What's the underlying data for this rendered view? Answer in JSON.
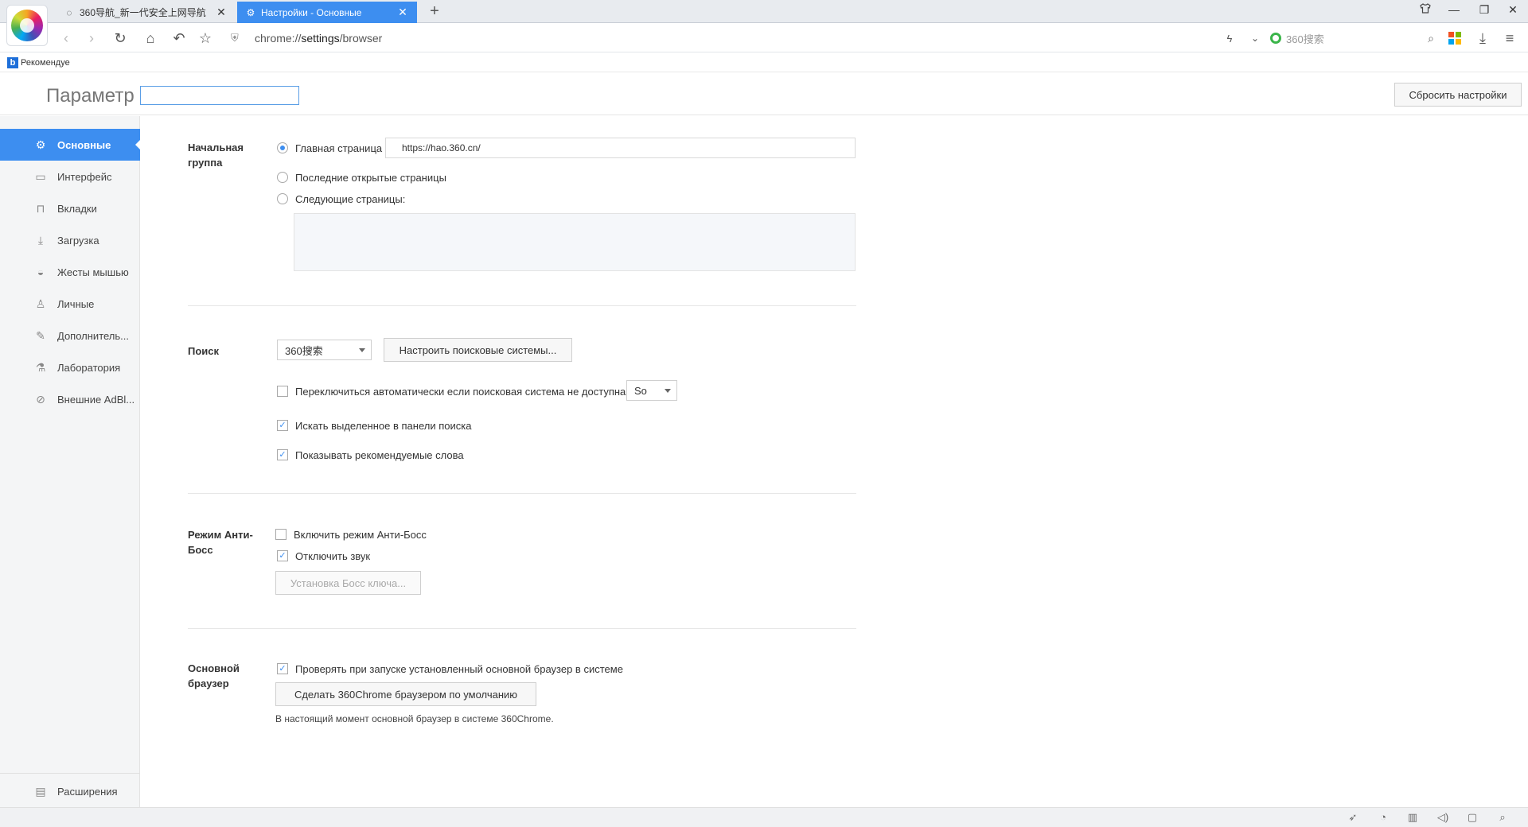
{
  "browser": {
    "tabs": [
      {
        "title": "360导航_新一代安全上网导航",
        "icon": "loading-spinner-icon",
        "close": "✕"
      },
      {
        "title": "Настройки - Основные",
        "icon": "gear-icon",
        "close": "✕"
      }
    ],
    "new_tab": "+",
    "address": {
      "prefix": "chrome://",
      "host": "settings",
      "path": "/browser"
    },
    "search_engine_placeholder": "360搜索",
    "bookmark": {
      "label": "Рекомендуе",
      "icon": "b"
    }
  },
  "settings": {
    "title": "Параметр",
    "reset_label": "Сбросить настройки",
    "nav": [
      {
        "label": "Основные",
        "icon": "gear-icon",
        "active": true
      },
      {
        "label": "Интерфейс",
        "icon": "window-icon",
        "active": false
      },
      {
        "label": "Вкладки",
        "icon": "tab-icon",
        "active": false
      },
      {
        "label": "Загрузка",
        "icon": "download-icon",
        "active": false
      },
      {
        "label": "Жесты мышью",
        "icon": "mouse-icon",
        "active": false
      },
      {
        "label": "Личные",
        "icon": "user-icon",
        "active": false
      },
      {
        "label": "Дополнитель...",
        "icon": "tools-icon",
        "active": false
      },
      {
        "label": "Лаборатория",
        "icon": "flask-icon",
        "active": false
      },
      {
        "label": "Внешние AdBl...",
        "icon": "block-icon",
        "active": false
      }
    ],
    "extensions_label": "Расширения",
    "startup": {
      "label": "Начальная группа",
      "home_label": "Главная страница",
      "home_url": "https://hao.360.cn/",
      "last_pages_label": "Последние открытые страницы",
      "next_pages_label": "Следующие страницы:",
      "selected": "home"
    },
    "search": {
      "label": "Поиск",
      "engine": "360搜索",
      "configure_label": "Настроить поисковые системы...",
      "auto_switch_label": "Переключиться автоматически если поисковая система не доступна",
      "auto_switch_checked": false,
      "fallback_engine": "So",
      "search_selected_label": "Искать выделенное в панели поиска",
      "search_selected_checked": true,
      "show_suggestions_label": "Показывать рекомендуемые слова",
      "show_suggestions_checked": true
    },
    "antiboss": {
      "label": "Режим Анти-Босс",
      "enable_label": "Включить режим Анти-Босс",
      "enable_checked": false,
      "mute_label": "Отключить звук",
      "mute_checked": true,
      "hotkey_label": "Установка Босс ключа..."
    },
    "default_browser": {
      "label": "Основной браузер",
      "check_label": "Проверять при запуске установленный основной браузер в системе",
      "check_checked": true,
      "make_default_label": "Сделать 360Chrome браузером по умолчанию",
      "status_text": "В настоящий момент основной браузер в системе 360Chrome."
    }
  }
}
